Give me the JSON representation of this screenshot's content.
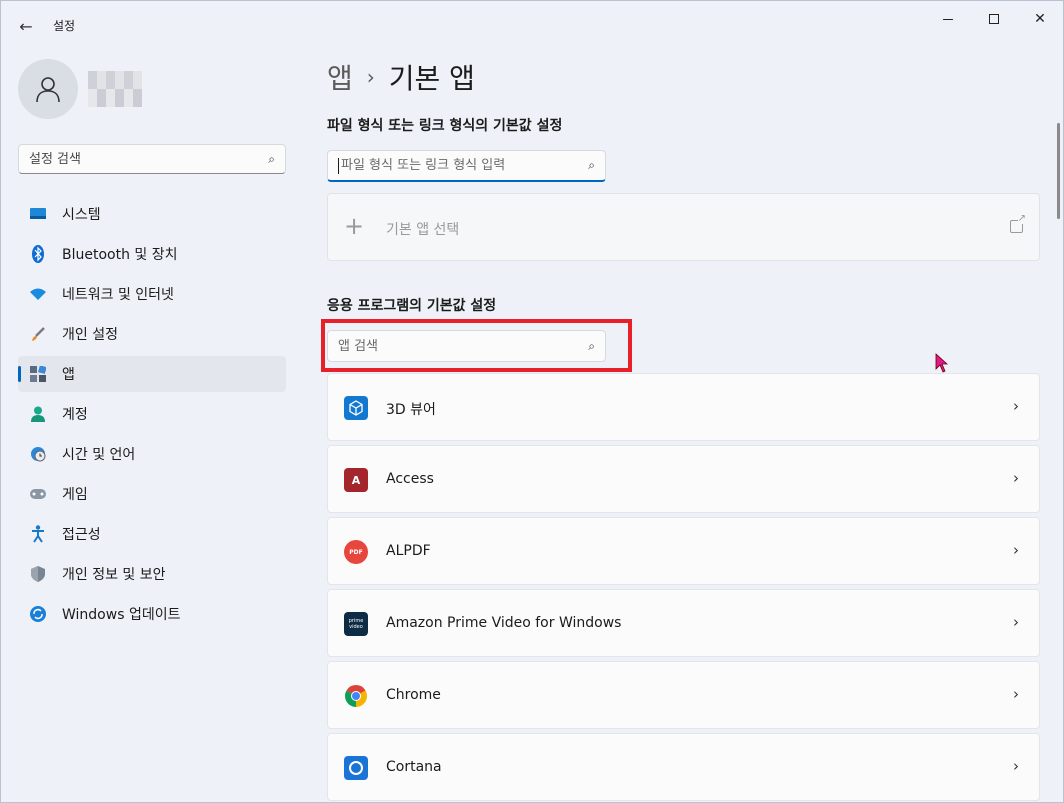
{
  "window": {
    "title": "설정"
  },
  "sidebar": {
    "search_placeholder": "설정 검색",
    "items": [
      {
        "label": "시스템",
        "icon": "system-display-icon"
      },
      {
        "label": "Bluetooth 및 장치",
        "icon": "bluetooth-icon"
      },
      {
        "label": "네트워크 및 인터넷",
        "icon": "wifi-icon"
      },
      {
        "label": "개인 설정",
        "icon": "paintbrush-icon"
      },
      {
        "label": "앱",
        "icon": "apps-icon",
        "active": true
      },
      {
        "label": "계정",
        "icon": "account-icon"
      },
      {
        "label": "시간 및 언어",
        "icon": "clock-globe-icon"
      },
      {
        "label": "게임",
        "icon": "gamepad-icon"
      },
      {
        "label": "접근성",
        "icon": "accessibility-icon"
      },
      {
        "label": "개인 정보 및 보안",
        "icon": "shield-icon"
      },
      {
        "label": "Windows 업데이트",
        "icon": "update-icon"
      }
    ]
  },
  "main": {
    "breadcrumb": {
      "parent": "앱",
      "separator": "›",
      "current": "기본 앱"
    },
    "file_section": {
      "title": "파일 형식 또는 링크 형식의 기본값 설정",
      "search_placeholder": "파일 형식 또는 링크 형식 입력",
      "choose_label": "기본 앱 선택"
    },
    "apps_section": {
      "title": "응용 프로그램의 기본값 설정",
      "search_placeholder": "앱 검색",
      "apps": [
        {
          "name": "3D 뷰어",
          "icon": "3d-viewer-icon"
        },
        {
          "name": "Access",
          "icon": "access-icon",
          "icon_text": "A"
        },
        {
          "name": "ALPDF",
          "icon": "alpdf-icon",
          "icon_text": "PDF"
        },
        {
          "name": "Amazon Prime Video for Windows",
          "icon": "prime-video-icon",
          "icon_text": "prime video"
        },
        {
          "name": "Chrome",
          "icon": "chrome-icon"
        },
        {
          "name": "Cortana",
          "icon": "cortana-icon"
        }
      ]
    }
  },
  "colors": {
    "accent": "#0067c0",
    "highlight": "#e8202a"
  }
}
